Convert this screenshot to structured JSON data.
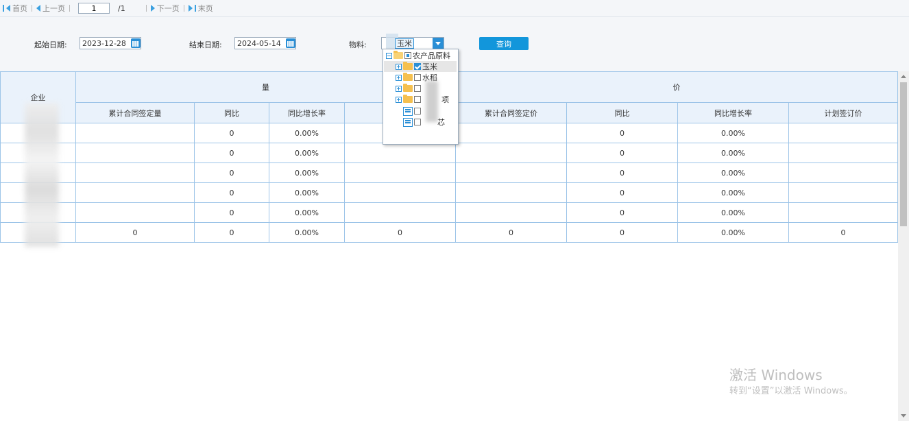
{
  "pager": {
    "first": "首页",
    "prev": "上一页",
    "current_page": "1",
    "total_pages": "/1",
    "next": "下一页",
    "last": "末页"
  },
  "filter": {
    "start_label": "起始日期:",
    "start_value": "2023-12-28",
    "end_label": "结束日期:",
    "end_value": "2024-05-14",
    "material_label": "物料:",
    "material_value": "玉米",
    "query_button": "查询"
  },
  "dropdown": {
    "root": "农产品原料",
    "items": [
      {
        "label": "玉米",
        "checked": true
      },
      {
        "label": "水稻",
        "checked": false
      },
      {
        "label": "",
        "checked": false
      },
      {
        "label": "项",
        "checked": false
      },
      {
        "label": "",
        "checked": false
      },
      {
        "label": "芯",
        "checked": false
      }
    ]
  },
  "table": {
    "enterprise_header": "企业",
    "group_volume": "量",
    "group_price": "价",
    "subheaders": [
      "累计合同签定量",
      "同比",
      "同比增长率",
      "",
      "累计合同签定价",
      "同比",
      "同比增长率",
      "计划签订价"
    ],
    "rows": [
      [
        "",
        "",
        "0",
        "0.00%",
        "",
        "",
        "0",
        "0.00%",
        ""
      ],
      [
        "",
        "",
        "0",
        "0.00%",
        "",
        "",
        "0",
        "0.00%",
        ""
      ],
      [
        "",
        "",
        "0",
        "0.00%",
        "",
        "",
        "0",
        "0.00%",
        ""
      ],
      [
        "",
        "",
        "0",
        "0.00%",
        "",
        "",
        "0",
        "0.00%",
        ""
      ],
      [
        "",
        "",
        "0",
        "0.00%",
        "",
        "",
        "0",
        "0.00%",
        ""
      ],
      [
        "",
        "0",
        "0",
        "0.00%",
        "0",
        "0",
        "0",
        "0.00%",
        "0"
      ]
    ]
  },
  "watermark": {
    "line1": "激活 Windows",
    "line2": "转到“设置”以激活 Windows。"
  },
  "colors": {
    "accent": "#1296db",
    "header_bg": "#eaf2fb",
    "border": "#9cc4e8"
  }
}
